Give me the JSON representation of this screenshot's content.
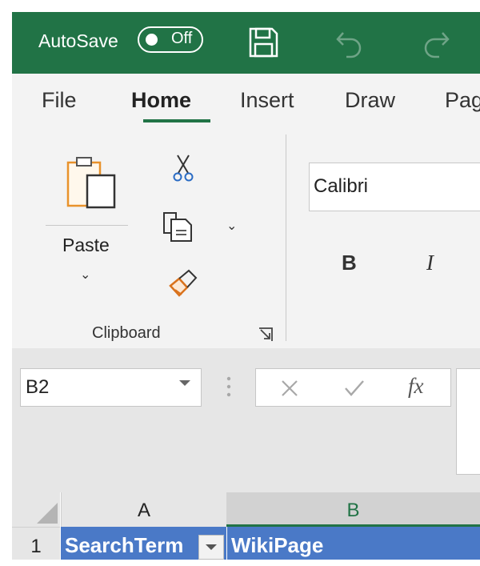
{
  "titlebar": {
    "autosave_label": "AutoSave",
    "autosave_state": "Off",
    "accent": "#217346"
  },
  "tabs": [
    {
      "label": "File"
    },
    {
      "label": "Home",
      "active": true
    },
    {
      "label": "Insert"
    },
    {
      "label": "Draw"
    },
    {
      "label": "Pag"
    }
  ],
  "ribbon": {
    "paste_label": "Paste",
    "group_label": "Clipboard",
    "font_name": "Calibri",
    "bold_label": "B",
    "italic_label": "I",
    "icons": [
      "paste-icon",
      "cut-icon",
      "copy-icon",
      "format-painter-icon",
      "dialog-launcher-icon"
    ]
  },
  "formula_bar": {
    "name_box": "B2",
    "fx_label": "fx",
    "formula": ""
  },
  "grid": {
    "columns": [
      "A",
      "B"
    ],
    "rows": [
      {
        "number": "1",
        "cells": [
          "SearchTerm",
          "WikiPage"
        ]
      }
    ],
    "header_fill": "#4a79c7"
  }
}
